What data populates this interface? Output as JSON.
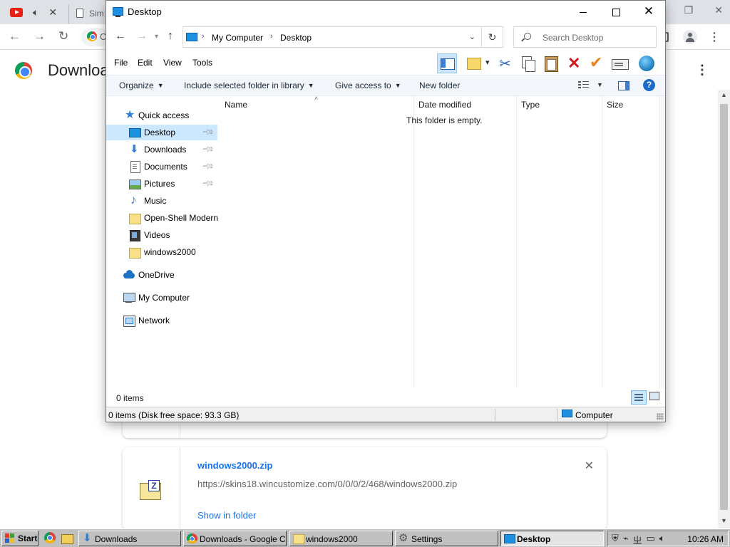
{
  "chrome": {
    "tab2_label": "Sim",
    "omnibox_fragment": "C",
    "page_title": "Downloa",
    "download_card": {
      "filename": "windows2000.zip",
      "url": "https://skins18.wincustomize.com/0/0/0/2/468/windows2000.zip",
      "show_in_folder": "Show in folder"
    }
  },
  "explorer": {
    "title": "Desktop",
    "address": {
      "segments": [
        "My Computer",
        "Desktop"
      ]
    },
    "search_placeholder": "Search Desktop",
    "menu": [
      "File",
      "Edit",
      "View",
      "Tools"
    ],
    "commands": {
      "organize": "Organize",
      "include_library": "Include selected folder in library",
      "give_access": "Give access to",
      "new_folder": "New folder"
    },
    "nav_pane": {
      "quick_access": "Quick access",
      "pinned": [
        "Desktop",
        "Downloads",
        "Documents",
        "Pictures"
      ],
      "folders": [
        "Music",
        "Open-Shell Modern",
        "Videos",
        "windows2000"
      ],
      "onedrive": "OneDrive",
      "my_computer": "My Computer",
      "network": "Network",
      "selected": "Desktop"
    },
    "columns": [
      "Name",
      "Date modified",
      "Type",
      "Size"
    ],
    "empty_message": "This folder is empty.",
    "item_count": "0 items",
    "status": {
      "text": "0 items (Disk free space: 93.3 GB)",
      "zone": "Computer"
    },
    "icons": [
      "back-icon",
      "forward-icon",
      "up-icon",
      "refresh-icon",
      "search-icon",
      "cut-icon",
      "copy-icon",
      "paste-icon",
      "delete-icon",
      "help-icon"
    ]
  },
  "taskbar": {
    "start": "Start",
    "tasks": [
      "Downloads",
      "Downloads - Google C...",
      "windows2000",
      "Settings",
      "Desktop"
    ],
    "active_task": "Desktop",
    "clock": "10:26 AM"
  },
  "colors": {
    "selection": "#cce8ff",
    "link": "#1a73e8",
    "taskbar": "#c0c0c0",
    "delete_red": "#d11919"
  }
}
